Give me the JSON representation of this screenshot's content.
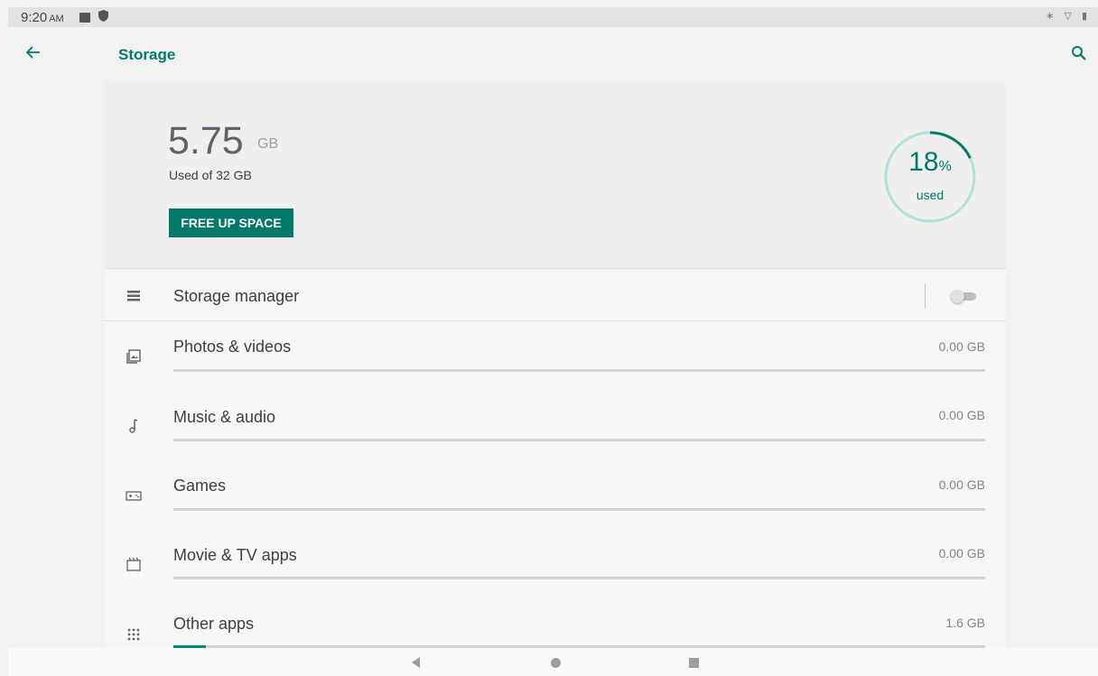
{
  "status_bar": {
    "time": "9:20",
    "ampm": "AM",
    "right_icons": [
      "bluetooth-icon",
      "wifi-icon",
      "battery-icon"
    ],
    "right_text": "∗ ▽ ▮"
  },
  "app_bar": {
    "back_icon": "arrow-left-icon",
    "title": "Storage",
    "search_icon": "search-icon"
  },
  "summary": {
    "used_value": "5.75",
    "used_unit": "GB",
    "used_of": "Used of 32 GB",
    "free_up_label": "FREE UP SPACE",
    "percent": "18",
    "percent_sign": "%",
    "percent_label": "used",
    "percent_fraction": 0.18
  },
  "storage_manager": {
    "label": "Storage manager",
    "icon": "storage-list-icon",
    "enabled": false
  },
  "categories": [
    {
      "label": "Photos & videos",
      "value": "0.00 GB",
      "icon": "photos-icon",
      "fraction": 0
    },
    {
      "label": "Music & audio",
      "value": "0.00 GB",
      "icon": "music-note-icon",
      "fraction": 0
    },
    {
      "label": "Games",
      "value": "0.00 GB",
      "icon": "gamepad-icon",
      "fraction": 0
    },
    {
      "label": "Movie & TV apps",
      "value": "0.00 GB",
      "icon": "movie-icon",
      "fraction": 0
    },
    {
      "label": "Other apps",
      "value": "1.6 GB",
      "icon": "apps-grid-icon",
      "fraction": 0.04
    }
  ],
  "colors": {
    "accent": "#00796b",
    "bar_fill": "#00897b",
    "ring_track": "#b2dfdb"
  },
  "nav_bar": {
    "back_icon": "nav-back-icon",
    "home_icon": "nav-home-icon",
    "recents_icon": "nav-recents-icon"
  }
}
